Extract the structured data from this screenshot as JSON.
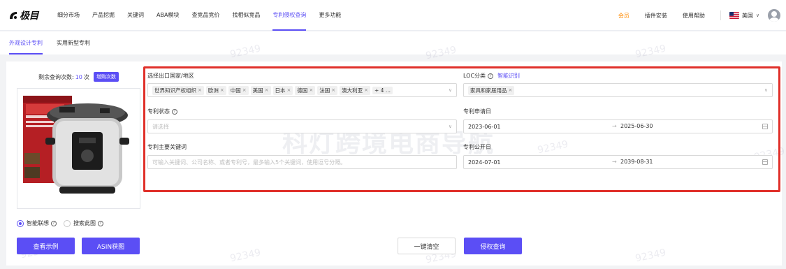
{
  "brand": {
    "name": "极目"
  },
  "nav": {
    "items": [
      {
        "label": "细分市场"
      },
      {
        "label": "产品挖掘"
      },
      {
        "label": "关键词"
      },
      {
        "label": "ABA模块"
      },
      {
        "label": "查竞品竞价"
      },
      {
        "label": "找相似竞品"
      },
      {
        "label": "专利侵权查询"
      },
      {
        "label": "更多功能"
      }
    ],
    "active_index": 6
  },
  "topright": {
    "vip": "会员",
    "plugin": "插件安装",
    "help": "使用帮助",
    "language": "美国"
  },
  "subtabs": {
    "design": "外观设计专利",
    "utility": "实用新型专利"
  },
  "left": {
    "remain_label": "剩余查询次数:",
    "remain_count": "10",
    "remain_unit": "次",
    "buy_label": "增购次数",
    "radio_smart": "智能联想",
    "radio_search": "搜索此图",
    "example_btn": "查看示例",
    "asin_btn": "ASIN获图"
  },
  "form": {
    "country_label": "选择出口国家/地区",
    "country_tags": [
      "世界知识产权组织",
      "欧洲",
      "中国",
      "美国",
      "日本",
      "德国",
      "法国",
      "澳大利亚"
    ],
    "country_more": "+ 4 ...",
    "loc_label": "LOC分类",
    "loc_link": "智能识别",
    "loc_tag": "家具和家居用品",
    "status_label": "专利状态",
    "status_placeholder": "请选择",
    "apply_date_label": "专利申请日",
    "apply_start": "2023-06-01",
    "apply_end": "2025-06-30",
    "keyword_label": "专利主要关键词",
    "keyword_placeholder": "可输入关键词、公司名称、或者专利号，最多输入5个关键词，使用逗号分隔。",
    "publish_date_label": "专利公开日",
    "publish_start": "2024-07-01",
    "publish_end": "2039-08-31"
  },
  "actions": {
    "clear": "一键清空",
    "query": "侵权查询"
  },
  "watermark": {
    "id": "92349",
    "site": "科灯跨境电商导航"
  },
  "colors": {
    "accent": "#5b4ef5",
    "highlight": "#e0302a",
    "vip": "#ff8a00"
  }
}
